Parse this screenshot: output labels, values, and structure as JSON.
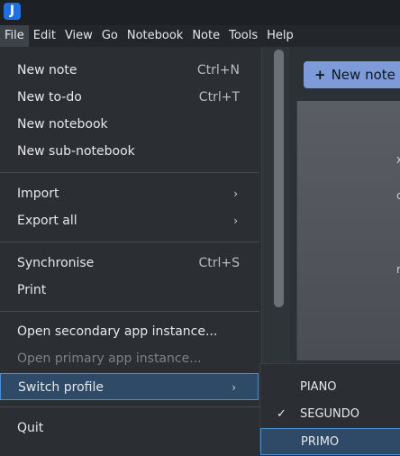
{
  "app": {
    "icon_letter": "J"
  },
  "menubar": {
    "items": [
      "File",
      "Edit",
      "View",
      "Go",
      "Notebook",
      "Note",
      "Tools",
      "Help"
    ]
  },
  "background": {
    "new_note_label": "New note",
    "edge_glyphs": [
      "x",
      "c",
      "r"
    ]
  },
  "file_menu": {
    "items": [
      {
        "label": "New note",
        "shortcut": "Ctrl+N"
      },
      {
        "label": "New to-do",
        "shortcut": "Ctrl+T"
      },
      {
        "label": "New notebook",
        "shortcut": ""
      },
      {
        "label": "New sub-notebook",
        "shortcut": ""
      },
      {
        "label": "Import",
        "submenu": true
      },
      {
        "label": "Export all",
        "submenu": true
      },
      {
        "label": "Synchronise",
        "shortcut": "Ctrl+S"
      },
      {
        "label": "Print",
        "shortcut": ""
      },
      {
        "label": "Open secondary app instance...",
        "shortcut": ""
      },
      {
        "label": "Open primary app instance...",
        "disabled": true
      },
      {
        "label": "Switch profile",
        "submenu": true,
        "selected": true
      },
      {
        "label": "Quit",
        "shortcut": ""
      }
    ]
  },
  "profile_submenu": {
    "items": [
      {
        "label": "PIANO",
        "checked": false
      },
      {
        "label": "SEGUNDO",
        "checked": true
      },
      {
        "label": "PRIMO",
        "checked": false,
        "selected": true
      }
    ],
    "check_glyph": "✓"
  },
  "glyphs": {
    "submenu_arrow": "›",
    "plus": "+"
  },
  "colors": {
    "accent": "#4a8ed8",
    "selection_bg": "#2f4a66",
    "button_bg": "#7c9bd8"
  }
}
